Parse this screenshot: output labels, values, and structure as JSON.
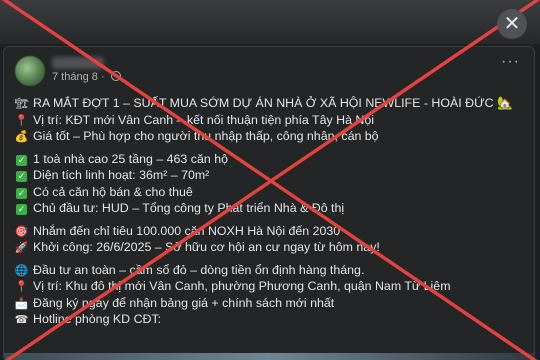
{
  "post": {
    "date": "7 tháng 8",
    "more_label": "···",
    "lines": [
      {
        "icon": "building-icon",
        "glyph": "🏗",
        "text": "RA MẮT ĐỢT 1 – SUẤT MUA SỚM DỰ ÁN NHÀ Ở XÃ HỘI NEWLIFE - HOÀI ĐỨC 🏡"
      },
      {
        "icon": "pin-icon",
        "glyph": "📍",
        "text": "Vị trí: KĐT mới Vân Canh – kết nối thuận tiện phía Tây Hà Nội"
      },
      {
        "icon": "money-bag-icon",
        "glyph": "💰",
        "text": "Giá tốt – Phù hợp cho người thu nhập thấp, công nhân, cán bộ"
      },
      {
        "icon": "check-icon",
        "glyph": "✓",
        "text": "1 toà nhà cao 25 tầng – 463 căn hộ"
      },
      {
        "icon": "check-icon",
        "glyph": "✓",
        "text": "Diện tích linh hoạt: 36m² – 70m²"
      },
      {
        "icon": "check-icon",
        "glyph": "✓",
        "text": "Có cả căn hộ bán & cho thuê"
      },
      {
        "icon": "check-icon",
        "glyph": "✓",
        "text": "Chủ đầu tư: HUD – Tổng công ty Phát triển Nhà & Đô thị"
      },
      {
        "icon": "target-icon",
        "glyph": "🎯",
        "text": "Nhắm đến chỉ tiêu 100.000 căn NOXH Hà Nội đến 2030"
      },
      {
        "icon": "rocket-icon",
        "glyph": "🚀",
        "text": "Khởi công: 26/6/2025 – Sở hữu cơ hội an cư ngay từ hôm nay!"
      },
      {
        "icon": "globe-icon",
        "glyph": "🌐",
        "text": "Đầu tư an toàn – cầm sổ đỏ – dòng tiền ổn định hàng tháng."
      },
      {
        "icon": "pin-icon",
        "glyph": "📍",
        "text": "Vị trí: Khu đô thị mới Vân Canh, phường Phương Canh, quận Nam Từ Liêm"
      },
      {
        "icon": "mail-icon",
        "glyph": "📩",
        "text": "Đăng ký ngay để nhận bảng giá + chính sách mới nhất"
      },
      {
        "icon": "phone-icon",
        "glyph": "☎",
        "text": "Hotline phòng KD CĐT: "
      }
    ]
  },
  "close_label": "✕",
  "overlay": {
    "cross_color": "#e0443c"
  }
}
